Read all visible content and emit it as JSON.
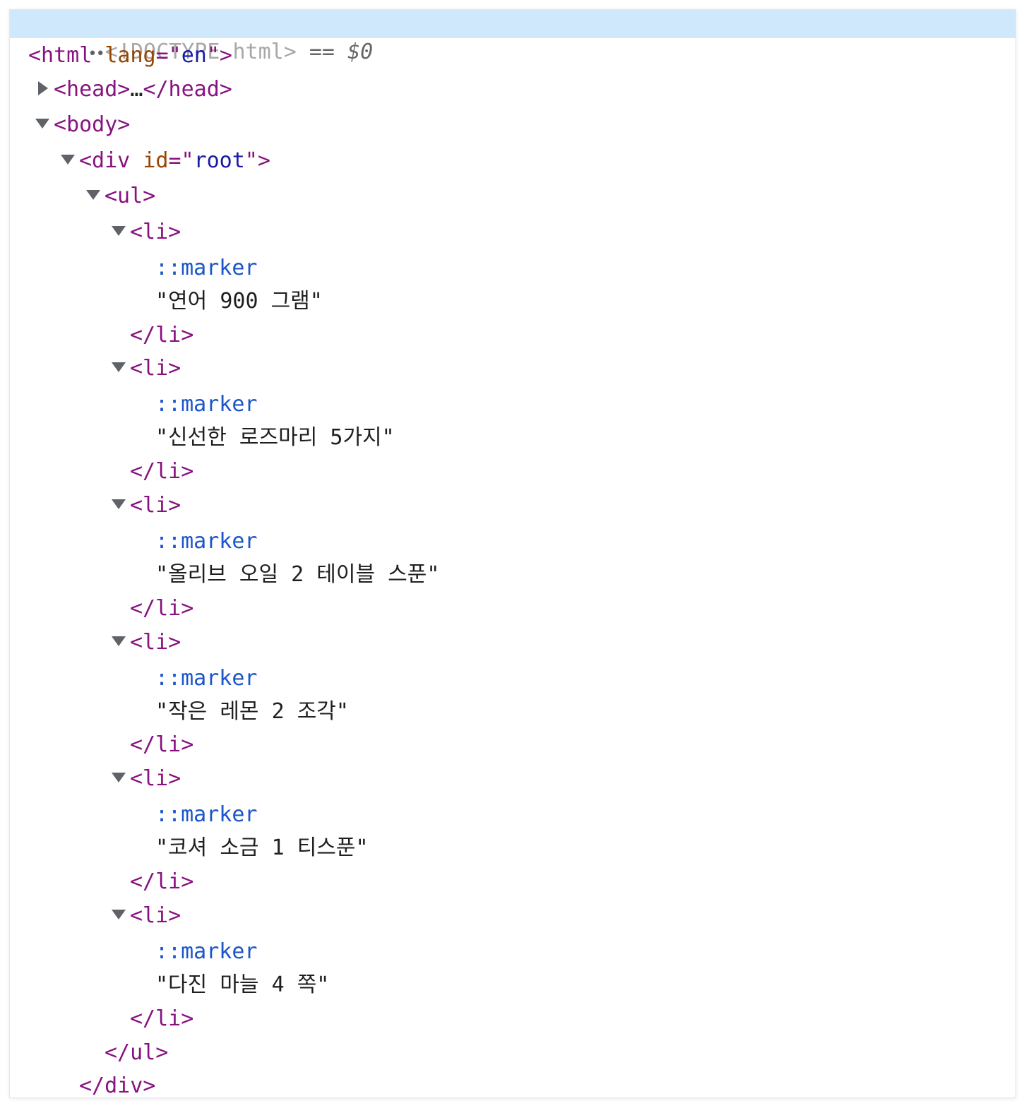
{
  "dom_tree": {
    "doctype_line": {
      "dots": "••",
      "text": "<!DOCTYPE html>",
      "eq": "==",
      "ref": "$0"
    },
    "html_open": {
      "tag_start": "<html",
      "attr_name": "lang",
      "attr_eq": "=\"",
      "attr_value": "en",
      "attr_close": "\">"
    },
    "head": {
      "open": "<head>",
      "ellipsis": "…",
      "close": "</head>"
    },
    "body_open": "<body>",
    "div_open": {
      "tag_start": "<div",
      "attr_name": "id",
      "attr_eq": "=\"",
      "attr_value": "root",
      "attr_close": "\">"
    },
    "ul_open": "<ul>",
    "li_open": "<li>",
    "li_close": "</li>",
    "marker": "::marker",
    "items": [
      "\"연어 900 그램\"",
      "\"신선한 로즈마리 5가지\"",
      "\"올리브 오일 2 테이블 스푼\"",
      "\"작은 레몬 2 조각\"",
      "\"코셔 소금 1 티스푼\"",
      "\"다진 마늘 4 쪽\""
    ],
    "ul_close": "</ul>",
    "div_close": "</div>"
  },
  "colors": {
    "tag": "#881280",
    "attribute_name": "#994500",
    "attribute_value": "#1a1aa6",
    "pseudo": "#1a55c9",
    "selection": "#cfe8fc"
  }
}
